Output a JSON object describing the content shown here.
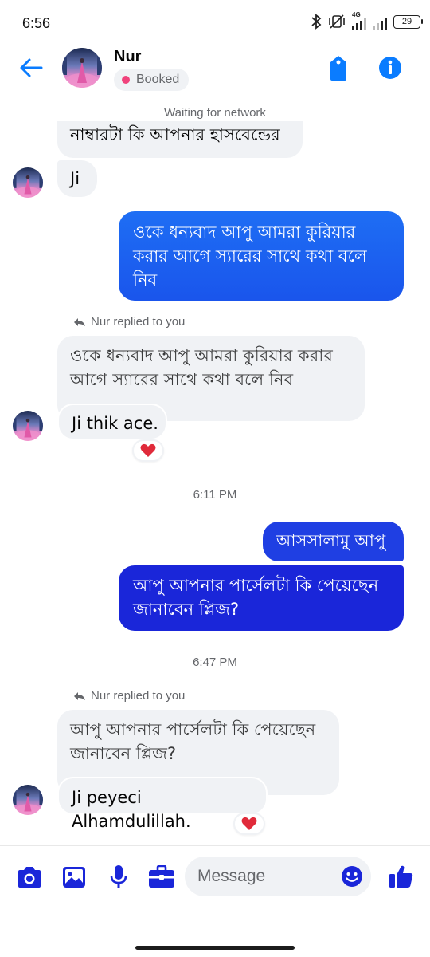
{
  "status_bar": {
    "time": "6:56",
    "battery": "29",
    "network": "4G"
  },
  "header": {
    "name": "Nur",
    "status_label": "Booked"
  },
  "network_note": "Waiting for network",
  "colors": {
    "accent": "#0a7cff",
    "brand_dark": "#1a26d9",
    "pill_dot": "#f0427c",
    "bubble_in": "#f0f2f5"
  },
  "messages": [
    {
      "text": "নাম্বারটা কি আপনার হাসবেন্ডের",
      "sender": "Nur"
    },
    {
      "text": "Ji",
      "sender": "Nur"
    },
    {
      "text": "ওকে ধন্যবাদ আপু আমরা কুরিয়ার করার আগে স্যারের সাথে কথা বলে নিব",
      "sender": "me"
    },
    {
      "reply_note": "Nur replied to you",
      "quote": "ওকে ধন্যবাদ আপু আমরা কুরিয়ার করার আগে স্যারের সাথে কথা বলে নিব",
      "text": "Ji thik ace.",
      "reaction": "heart",
      "sender": "Nur"
    },
    {
      "time_separator": "6:11 PM"
    },
    {
      "text": "আসসালামু আপু",
      "sender": "me"
    },
    {
      "text": "আপু আপনার পার্সেলটা কি পেয়েছেন জানাবেন প্লিজ?",
      "sender": "me"
    },
    {
      "time_separator": "6:47 PM"
    },
    {
      "reply_note": "Nur replied to you",
      "quote": "আপু আপনার পার্সেলটা কি পেয়েছেন জানাবেন প্লিজ?",
      "text": "Ji peyeci Alhamdulillah.",
      "reaction": "heart",
      "sender": "Nur"
    }
  ],
  "composer": {
    "placeholder": "Message",
    "icons": [
      "camera-icon",
      "image-icon",
      "microphone-icon",
      "briefcase-icon",
      "emoji-icon",
      "thumbs-up-icon"
    ]
  }
}
